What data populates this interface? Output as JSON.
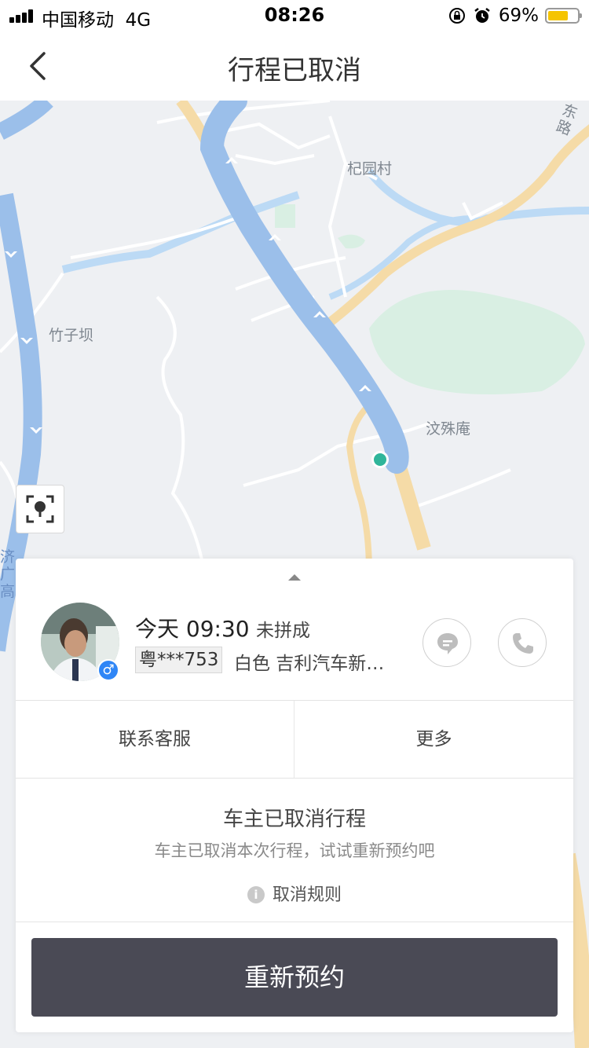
{
  "status_bar": {
    "carrier": "中国移动",
    "network": "4G",
    "time": "08:26",
    "battery_percent": "69%",
    "battery_level": 0.69,
    "battery_color": "#f5c400"
  },
  "nav": {
    "title": "行程已取消",
    "back_icon": "chevron-left-icon"
  },
  "map": {
    "labels": {
      "village": "杞园村",
      "area_left": "竹子坝",
      "temple": "汶殊庵",
      "road_east": "东路",
      "expressway": "济广高"
    },
    "route_color": "#9bbfea",
    "location_dot_color": "#2fb59a"
  },
  "trip": {
    "time": "今天 09:30",
    "status": "未拼成",
    "plate": "粤***753",
    "car_info": "白色 吉利汽车新…",
    "gender_symbol": "♂"
  },
  "actions": {
    "contact_service": "联系客服",
    "more": "更多"
  },
  "cancellation": {
    "title": "车主已取消行程",
    "description": "车主已取消本次行程，试试重新预约吧",
    "rules_link": "取消规则"
  },
  "rebook_button": "重新预约"
}
